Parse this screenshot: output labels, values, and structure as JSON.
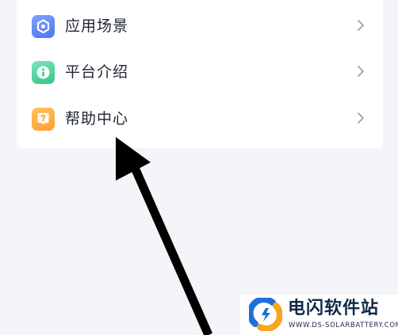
{
  "menu": {
    "items": [
      {
        "label": "应用场景",
        "icon": "hexagon-scene-icon",
        "color": "#5b7ff5"
      },
      {
        "label": "平台介绍",
        "icon": "info-icon",
        "color": "#3cc98e"
      },
      {
        "label": "帮助中心",
        "icon": "help-question-icon",
        "color": "#ffaa3a"
      }
    ]
  },
  "annotation": {
    "arrow_icon": "pointer-arrow-icon",
    "arrow_color": "#000000"
  },
  "watermark": {
    "title": "电闪软件站",
    "subtitle": "WWW.DS-SOLARBATTERY.COM",
    "colors": {
      "blue": "#1e6fd9",
      "orange": "#f7a51c"
    }
  },
  "theme": {
    "background": "#f4f5f8",
    "card": "#ffffff",
    "text": "#1f2430",
    "chevron": "#9aa0ab"
  }
}
